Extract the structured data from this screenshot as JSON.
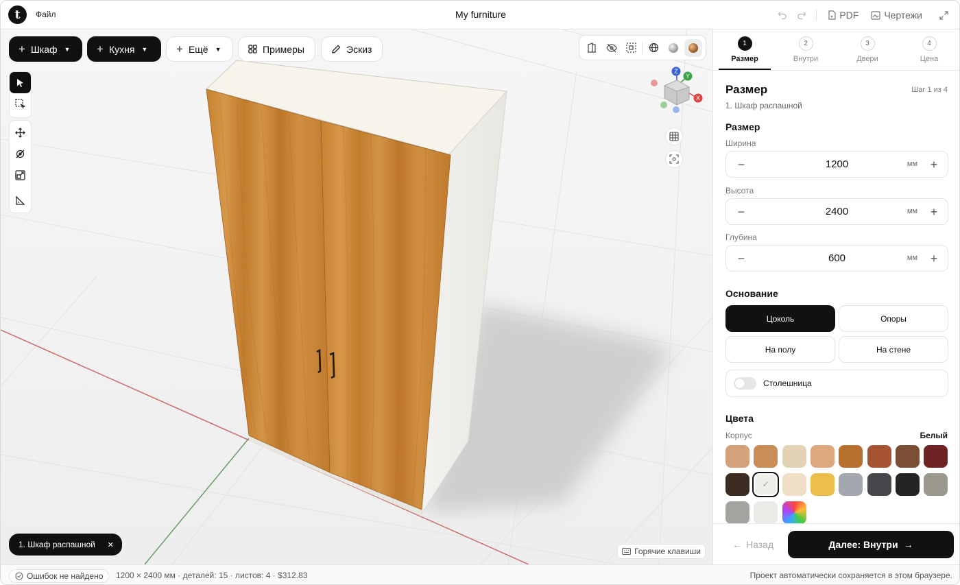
{
  "topbar": {
    "file_menu": "Файл",
    "title": "My furniture",
    "pdf_label": "PDF",
    "drawings_label": "Чертежи"
  },
  "toolbar": {
    "wardrobe_label": "Шкаф",
    "kitchen_label": "Кухня",
    "more_label": "Ещё",
    "examples_label": "Примеры",
    "sketch_label": "Эскиз"
  },
  "viewport": {
    "axes": {
      "z": "Z",
      "y": "Y",
      "x": "X"
    },
    "selection_chip": "1. Шкаф распашной",
    "hotkeys_label": "Горячие клавиши"
  },
  "steps": [
    {
      "num": "1",
      "label": "Размер",
      "active": true
    },
    {
      "num": "2",
      "label": "Внутри",
      "active": false
    },
    {
      "num": "3",
      "label": "Двери",
      "active": false
    },
    {
      "num": "4",
      "label": "Цена",
      "active": false
    }
  ],
  "panel": {
    "title": "Размер",
    "step_count": "Шаг 1 из 4",
    "subtitle": "1. Шкаф распашной",
    "size_section": "Размер",
    "width_label": "Ширина",
    "width_value": "1200",
    "height_label": "Высота",
    "height_value": "2400",
    "depth_label": "Глубина",
    "depth_value": "600",
    "unit": "мм",
    "base_section": "Основание",
    "base_options": [
      "Цоколь",
      "Опоры",
      "На полу",
      "На стене"
    ],
    "base_selected": "Цоколь",
    "countertop_label": "Столешница",
    "countertop_on": false,
    "colors_section": "Цвета",
    "body_label": "Корпус",
    "body_value": "Белый",
    "swatches": [
      "#d3a27a",
      "#c98e58",
      "#e2d3b4",
      "#dfa77e",
      "#b8702e",
      "#a65432",
      "#7a4f35",
      "#6e2424",
      "#3c2b20",
      "#efeee9",
      "#efdfc6",
      "#ecbe4a",
      "#a2a8ad",
      "#45474b",
      "#232426",
      "#9a978d",
      "#a5a3a0",
      "#ecebe8",
      "rainbow"
    ],
    "swatch_selected_index": 9,
    "back_label": "Назад",
    "next_label": "Далее: Внутри"
  },
  "status": {
    "errors": "Ошибок не найдено",
    "info": "1200 × 2400 мм · деталей: 15 · листов: 4 · $312.83",
    "autosave": "Проект автоматически сохраняется в этом браузере."
  }
}
